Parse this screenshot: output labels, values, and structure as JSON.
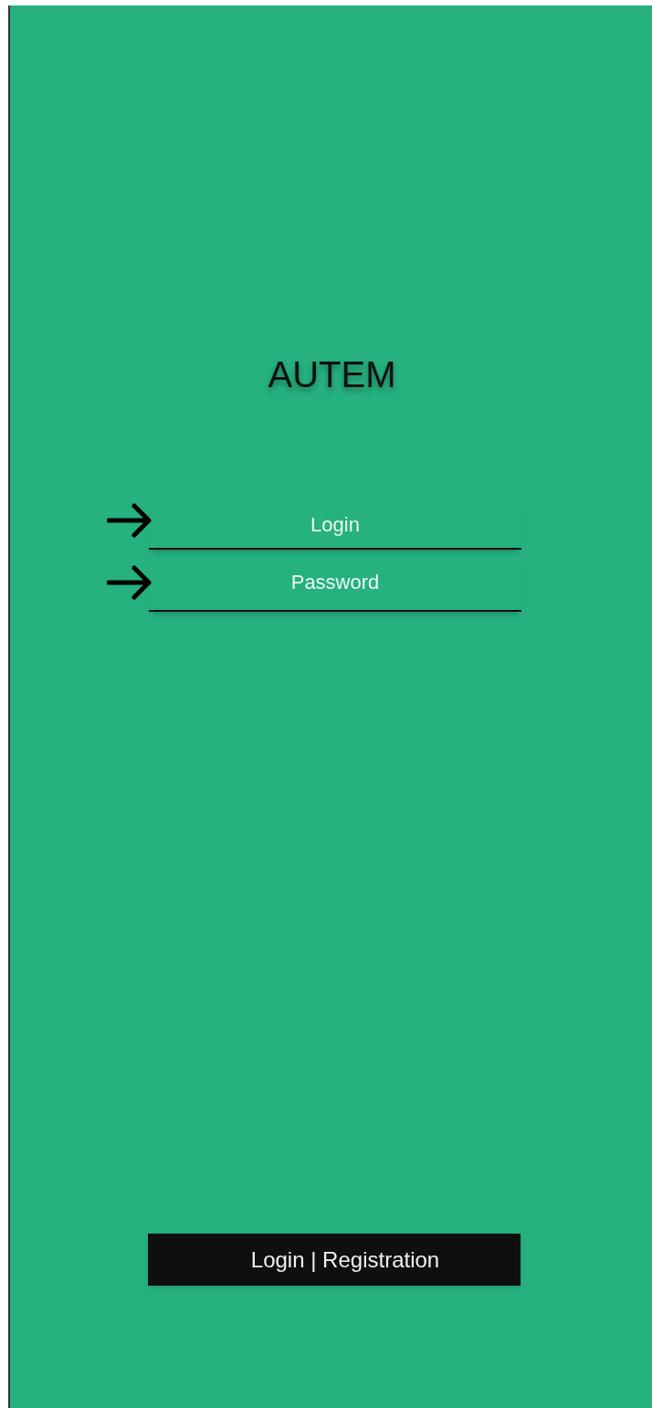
{
  "title": "AUTEM",
  "fields": [
    {
      "placeholder": "Login"
    },
    {
      "placeholder": "Password"
    }
  ],
  "button": {
    "label": "Login | Registration"
  }
}
